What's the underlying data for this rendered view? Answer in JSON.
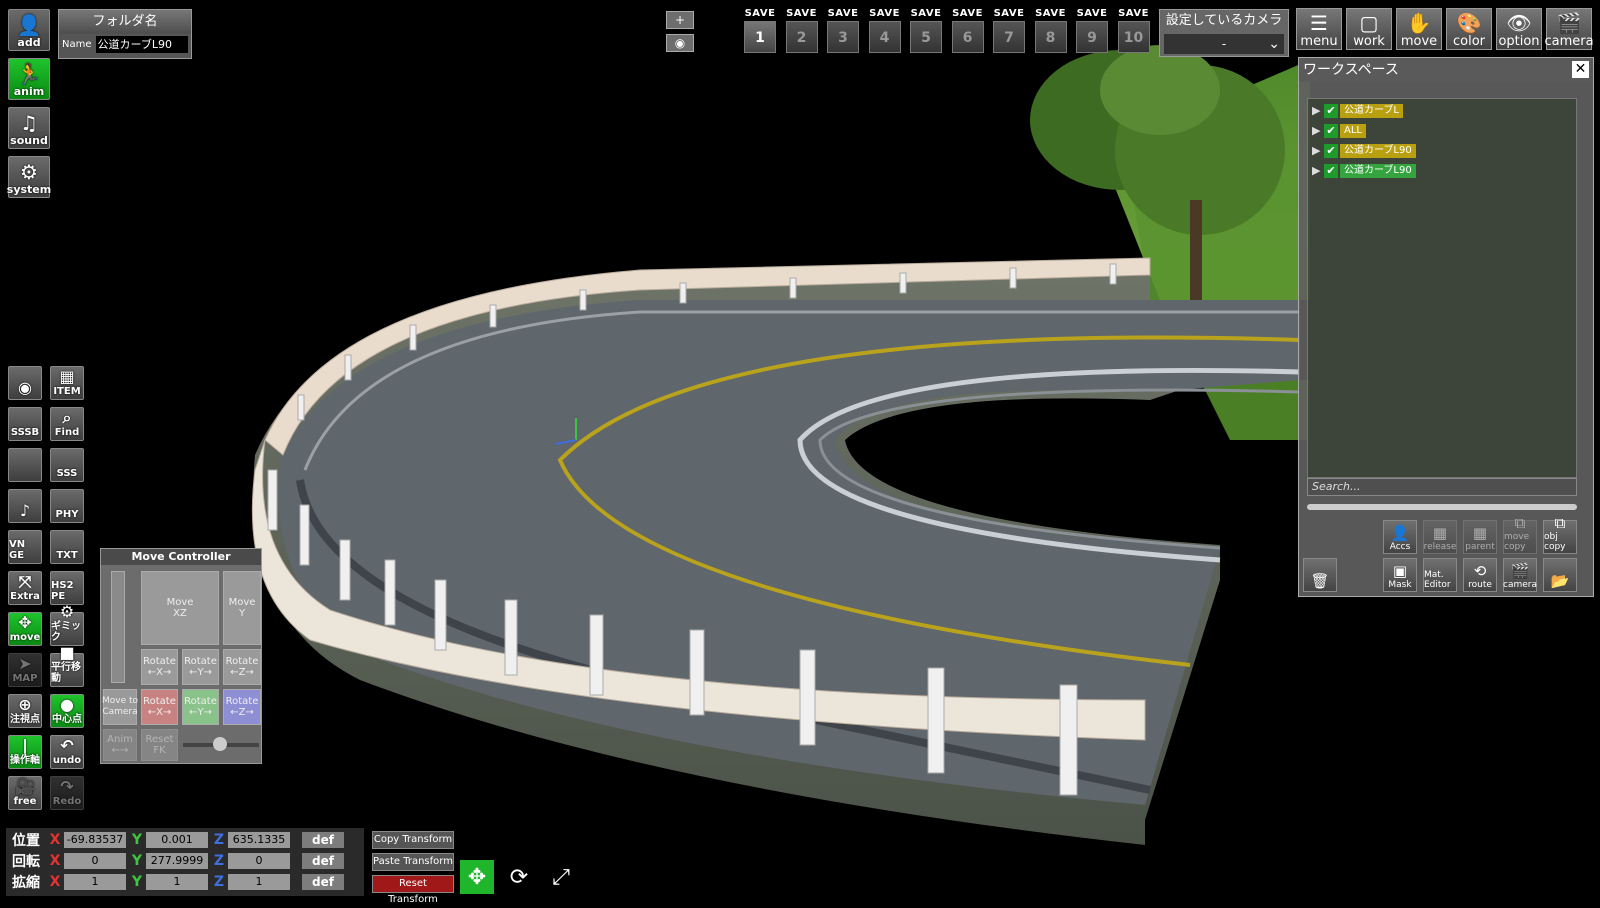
{
  "left_icons": [
    {
      "label": "add",
      "icon": "add-user-icon",
      "glyph": "👤"
    },
    {
      "label": "anim",
      "icon": "running-figure-icon",
      "glyph": "🏃"
    },
    {
      "label": "sound",
      "icon": "music-note-icon",
      "glyph": "♫"
    },
    {
      "label": "system",
      "icon": "gears-icon",
      "glyph": "⚙"
    }
  ],
  "folder": {
    "header": "フォルダ名",
    "name_label": "Name",
    "name_value": "公道カーブL90"
  },
  "top_center": {
    "plus": "+",
    "eye": "◉"
  },
  "save_slots": [
    {
      "label": "SAVE",
      "num": "1"
    },
    {
      "label": "SAVE",
      "num": "2"
    },
    {
      "label": "SAVE",
      "num": "3"
    },
    {
      "label": "SAVE",
      "num": "4"
    },
    {
      "label": "SAVE",
      "num": "5"
    },
    {
      "label": "SAVE",
      "num": "6"
    },
    {
      "label": "SAVE",
      "num": "7"
    },
    {
      "label": "SAVE",
      "num": "8"
    },
    {
      "label": "SAVE",
      "num": "9"
    },
    {
      "label": "SAVE",
      "num": "10"
    }
  ],
  "camera_select": {
    "title": "設定しているカメラ",
    "value": "-"
  },
  "top_buttons": [
    {
      "label": "menu",
      "glyph": "☰"
    },
    {
      "label": "work",
      "glyph": "▢"
    },
    {
      "label": "move",
      "glyph": "✋"
    },
    {
      "label": "color",
      "glyph": "🎨"
    },
    {
      "label": "option",
      "glyph": "👁"
    },
    {
      "label": "camera",
      "glyph": "🎬"
    }
  ],
  "tool_grid": [
    [
      "",
      "ITEM"
    ],
    [
      "SSSB",
      "Find"
    ],
    [
      "",
      "SSS"
    ],
    [
      "",
      "PHY"
    ],
    [
      "VN GE",
      "TXT"
    ],
    [
      "Extra",
      "HS2 PE"
    ],
    [
      "move",
      "ギミック"
    ],
    [
      "MAP",
      "平行移動"
    ],
    [
      "注視点",
      "中心点"
    ],
    [
      "操作軸",
      "undo"
    ],
    [
      "free",
      "Redo"
    ]
  ],
  "workspace": {
    "title": "ワークスペース",
    "close": "✕",
    "nodes": [
      "公道カーブL",
      "ALL",
      "公道カーブL90",
      "公道カーブL90"
    ],
    "search_placeholder": "Search...",
    "buttons_row1": [
      "Accs",
      "release",
      "parent",
      "move copy",
      "obj copy"
    ],
    "buttons_row2": [
      "",
      "Mask",
      "Mat. Editor",
      "route",
      "camera",
      ""
    ]
  },
  "move_controller": {
    "title": "Move Controller",
    "move_xz": "Move\nXZ",
    "move_y": "Move\nY",
    "rotate_x": "Rotate\n←X→",
    "rotate_y": "Rotate\n←Y→",
    "rotate_z": "Rotate\n←Z→",
    "move_to_camera": "Move to\nCamera",
    "anim": "Anim\n←→",
    "reset_fk": "Reset\nFK"
  },
  "transform": {
    "rows": [
      {
        "name": "位置",
        "x": "-69.83537",
        "y": "0.001",
        "z": "635.1335"
      },
      {
        "name": "回転",
        "x": "0",
        "y": "277.9999",
        "z": "0"
      },
      {
        "name": "拡縮",
        "x": "1",
        "y": "1",
        "z": "1"
      }
    ],
    "def": "def",
    "axis_x": "X",
    "axis_y": "Y",
    "axis_z": "Z",
    "copy": "Copy Transform",
    "paste": "Paste Transform",
    "reset": "Reset Transform"
  }
}
